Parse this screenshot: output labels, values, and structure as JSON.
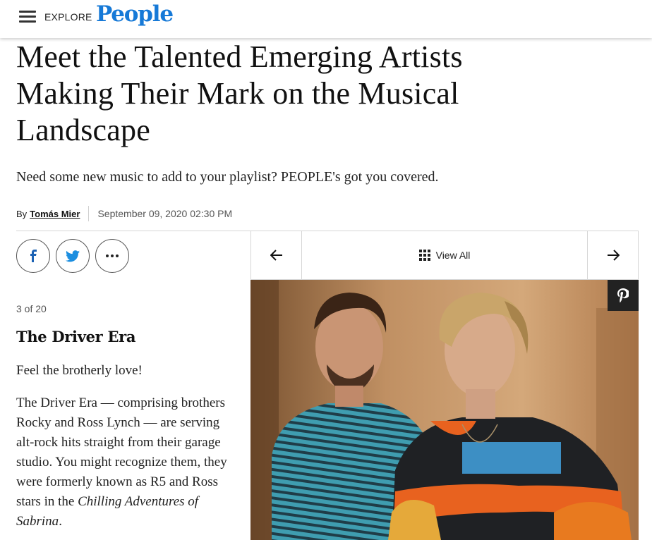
{
  "header": {
    "explore_label": "EXPLORE",
    "logo_text": "People",
    "logo_color": "#1679d7"
  },
  "article": {
    "headline": "Meet the Talented Emerging Artists Making Their Mark on the Musical Landscape",
    "dek": "Need some new music to add to your playlist? PEOPLE's got you covered.",
    "byline_prefix": "By",
    "author": "Tomás Mier",
    "date": "September 09, 2020 02:30 PM"
  },
  "share": {
    "icons": [
      "facebook-icon",
      "twitter-icon",
      "more-icon"
    ]
  },
  "gallery": {
    "view_all_label": "View All",
    "counter": "3 of 20",
    "slide_title": "The Driver Era",
    "slide_lead": "Feel the brotherly love!",
    "slide_body_text": "The Driver Era — comprising brothers Rocky and Ross Lynch — are serving alt-rock hits straight from their garage studio. You might recognize them, they were formerly known as R5 and Ross stars in the ",
    "slide_body_italic": "Chilling Adventures of Sabrina",
    "slide_body_end": "."
  }
}
